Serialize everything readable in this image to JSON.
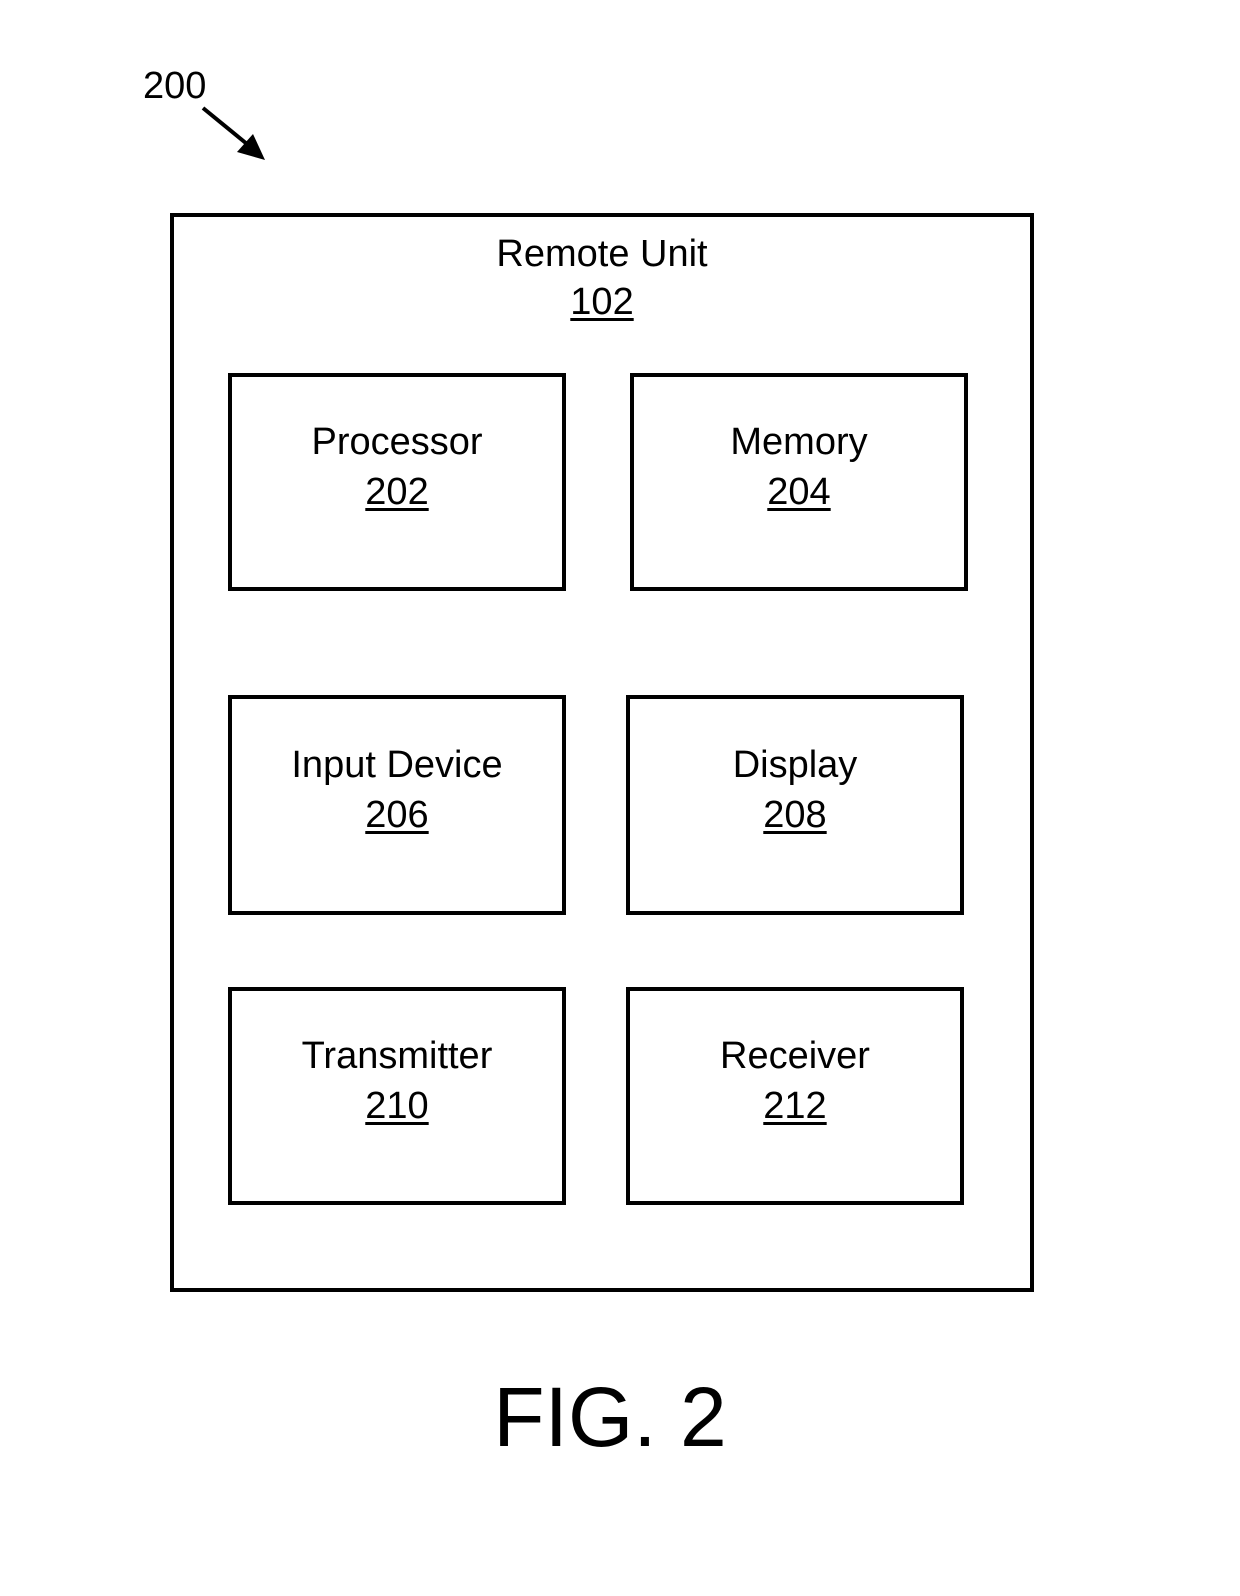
{
  "figure_ref": "200",
  "outer": {
    "title": "Remote Unit",
    "number": "102"
  },
  "components": [
    {
      "name": "Processor",
      "number": "202"
    },
    {
      "name": "Memory",
      "number": "204"
    },
    {
      "name": "Input Device",
      "number": "206"
    },
    {
      "name": "Display",
      "number": "208"
    },
    {
      "name": "Transmitter",
      "number": "210"
    },
    {
      "name": "Receiver",
      "number": "212"
    }
  ],
  "caption": "FIG. 2",
  "icons": {
    "arrow": "arrow-down-right-icon"
  }
}
